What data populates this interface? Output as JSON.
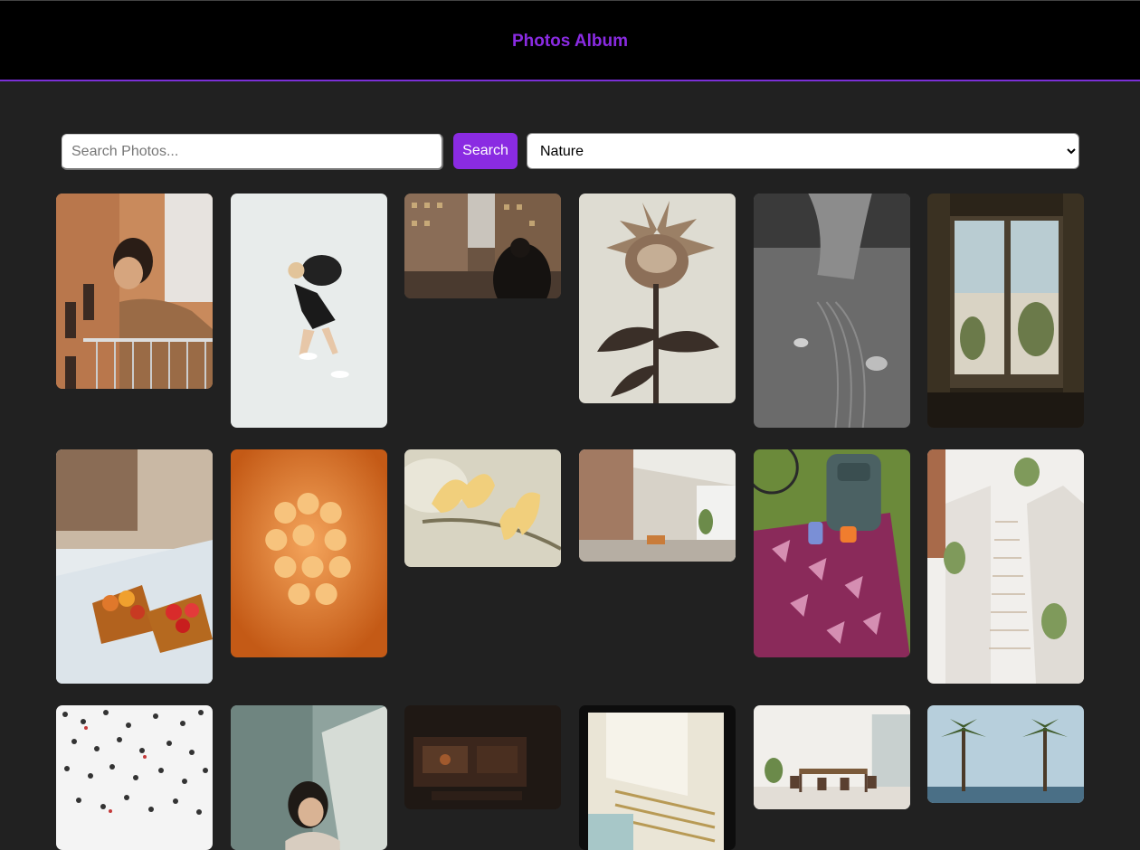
{
  "header": {
    "title": "Photos Album"
  },
  "search": {
    "placeholder": "Search Photos...",
    "button_label": "Search"
  },
  "category": {
    "selected": "Nature",
    "options": [
      "Nature"
    ]
  },
  "photos": [
    {
      "subject": "man-leaning-on-balcony"
    },
    {
      "subject": "woman-squat-with-sandbag"
    },
    {
      "subject": "city-street-crowd"
    },
    {
      "subject": "protea-flower"
    },
    {
      "subject": "hand-drawing-in-sand"
    },
    {
      "subject": "window-view"
    },
    {
      "subject": "fruit-tarts-by-window"
    },
    {
      "subject": "orange-abstract-shapes"
    },
    {
      "subject": "magnolia-blossom"
    },
    {
      "subject": "brick-loft-interior"
    },
    {
      "subject": "backpack-on-picnic-blanket"
    },
    {
      "subject": "white-stairway-architecture"
    },
    {
      "subject": "crowd-from-above"
    },
    {
      "subject": "woman-by-window-light"
    },
    {
      "subject": "dark-control-panel"
    },
    {
      "subject": "film-frame-architecture"
    },
    {
      "subject": "dining-room-interior"
    },
    {
      "subject": "palm-trees-by-sea"
    }
  ]
}
